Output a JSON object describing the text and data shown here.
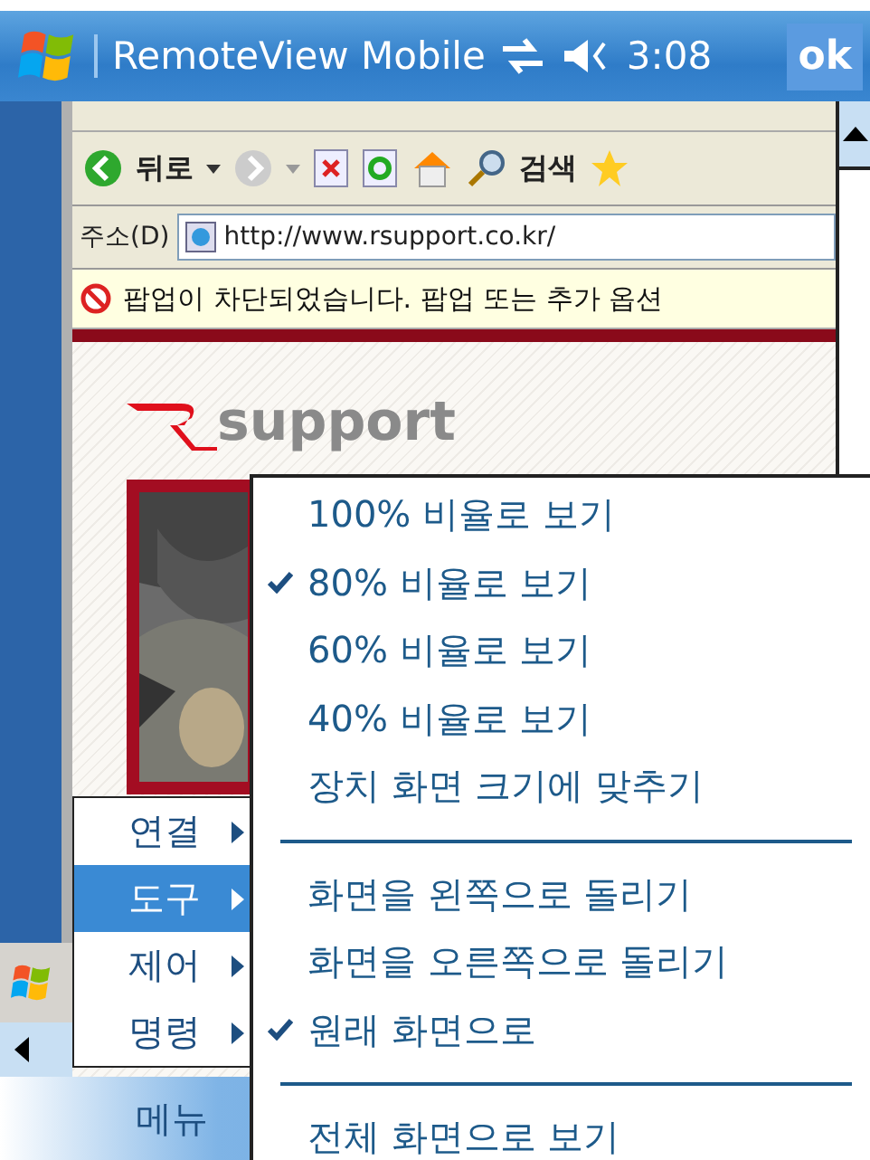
{
  "title_bar": {
    "title": "RemoteView Mobile",
    "time": "3:08",
    "ok_button": "ok"
  },
  "browser": {
    "toolbar": {
      "back": "뒤로",
      "search": "검색"
    },
    "address": {
      "label": "주소(D)",
      "url": "http://www.rsupport.co.kr/"
    },
    "popup_notice": "팝업이 차단되었습니다. 팝업 또는 추가 옵션",
    "logo_text": "support"
  },
  "menu": {
    "items": [
      {
        "label": "연결",
        "selected": false
      },
      {
        "label": "도구",
        "selected": true
      },
      {
        "label": "제어",
        "selected": false
      },
      {
        "label": "명령",
        "selected": false
      }
    ]
  },
  "submenu": {
    "items": [
      {
        "kind": "item",
        "label": "100% 비율로 보기",
        "checked": false
      },
      {
        "kind": "item",
        "label": "80% 비율로 보기",
        "checked": true
      },
      {
        "kind": "item",
        "label": "60% 비율로 보기",
        "checked": false
      },
      {
        "kind": "item",
        "label": "40% 비율로 보기",
        "checked": false
      },
      {
        "kind": "item",
        "label": "장치 화면 크기에 맞추기",
        "checked": false
      },
      {
        "kind": "separator"
      },
      {
        "kind": "item",
        "label": "화면을 왼쪽으로 돌리기",
        "checked": false
      },
      {
        "kind": "item",
        "label": "화면을 오른쪽으로 돌리기",
        "checked": false
      },
      {
        "kind": "item",
        "label": "원래 화면으로",
        "checked": true
      },
      {
        "kind": "separator"
      },
      {
        "kind": "item",
        "label": "전체 화면으로 보기",
        "checked": false
      }
    ]
  },
  "menu_bar": {
    "label": "메뉴"
  }
}
